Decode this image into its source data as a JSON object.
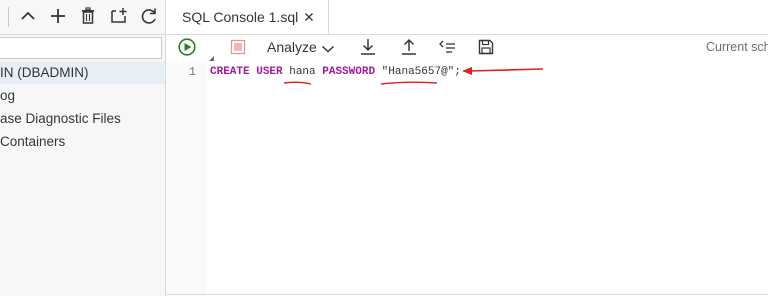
{
  "left_panel": {
    "tree_items": [
      {
        "label": "IN (DBADMIN)",
        "selected": true
      },
      {
        "label": "og",
        "selected": false
      },
      {
        "label": "ase Diagnostic Files",
        "selected": false
      },
      {
        "label": "Containers",
        "selected": false
      }
    ]
  },
  "tab": {
    "label": "SQL Console 1.sql"
  },
  "toolbar": {
    "analyze_label": "Analyze",
    "schema_label": "Current sche"
  },
  "editor": {
    "line_number": "1",
    "code": {
      "kw_create": "CREATE",
      "kw_user": "USER",
      "user_name": "hana",
      "kw_password": "PASSWORD",
      "password_value": "\"Hana5657@\"",
      "terminator": ";"
    }
  },
  "colors": {
    "keyword": "#a21a9a",
    "run": "#2b7d2b",
    "stop": "#e5959a",
    "annotation": "#e02020"
  }
}
